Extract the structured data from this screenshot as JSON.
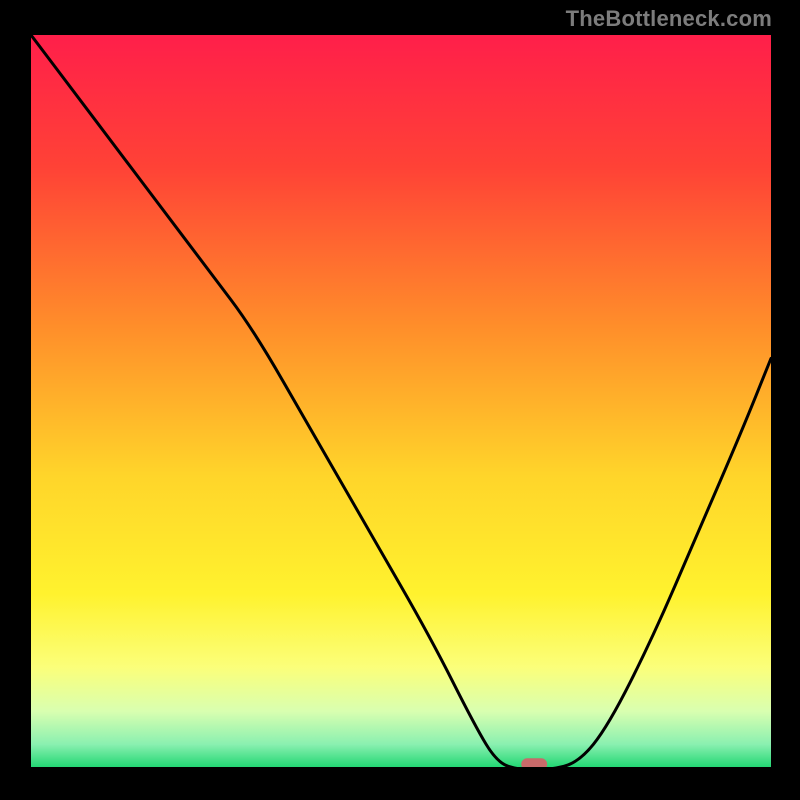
{
  "watermark": "TheBottleneck.com",
  "chart_data": {
    "type": "line",
    "title": "",
    "xlabel": "",
    "ylabel": "",
    "xlim": [
      0,
      100
    ],
    "ylim": [
      0,
      100
    ],
    "grid": false,
    "legend": false,
    "background": {
      "type": "vertical-gradient",
      "description": "red→orange→yellow→pale-yellow→pale-green→green from top to bottom",
      "stops": [
        {
          "pos": 0.0,
          "color": "#ff1f4a"
        },
        {
          "pos": 0.18,
          "color": "#ff4236"
        },
        {
          "pos": 0.4,
          "color": "#ff8f2a"
        },
        {
          "pos": 0.6,
          "color": "#ffd52a"
        },
        {
          "pos": 0.76,
          "color": "#fff22e"
        },
        {
          "pos": 0.86,
          "color": "#fbff7a"
        },
        {
          "pos": 0.92,
          "color": "#d9ffb0"
        },
        {
          "pos": 0.965,
          "color": "#8af0b0"
        },
        {
          "pos": 1.0,
          "color": "#16d46c"
        }
      ]
    },
    "series": [
      {
        "name": "bottleneck-curve",
        "color": "#000000",
        "x": [
          0,
          6,
          12,
          18,
          24,
          30,
          38,
          46,
          54,
          60,
          63,
          66,
          70,
          74,
          78,
          84,
          90,
          96,
          100
        ],
        "y": [
          100,
          92,
          84,
          76,
          68,
          60,
          46,
          32,
          18,
          6,
          1,
          0,
          0,
          1,
          6,
          18,
          32,
          46,
          56
        ]
      }
    ],
    "marker": {
      "name": "optimal-point",
      "shape": "rounded-rect",
      "x": 68,
      "y": 0.8,
      "width_pct": 3.5,
      "height_pct": 1.6,
      "color": "#c86a6a"
    }
  }
}
